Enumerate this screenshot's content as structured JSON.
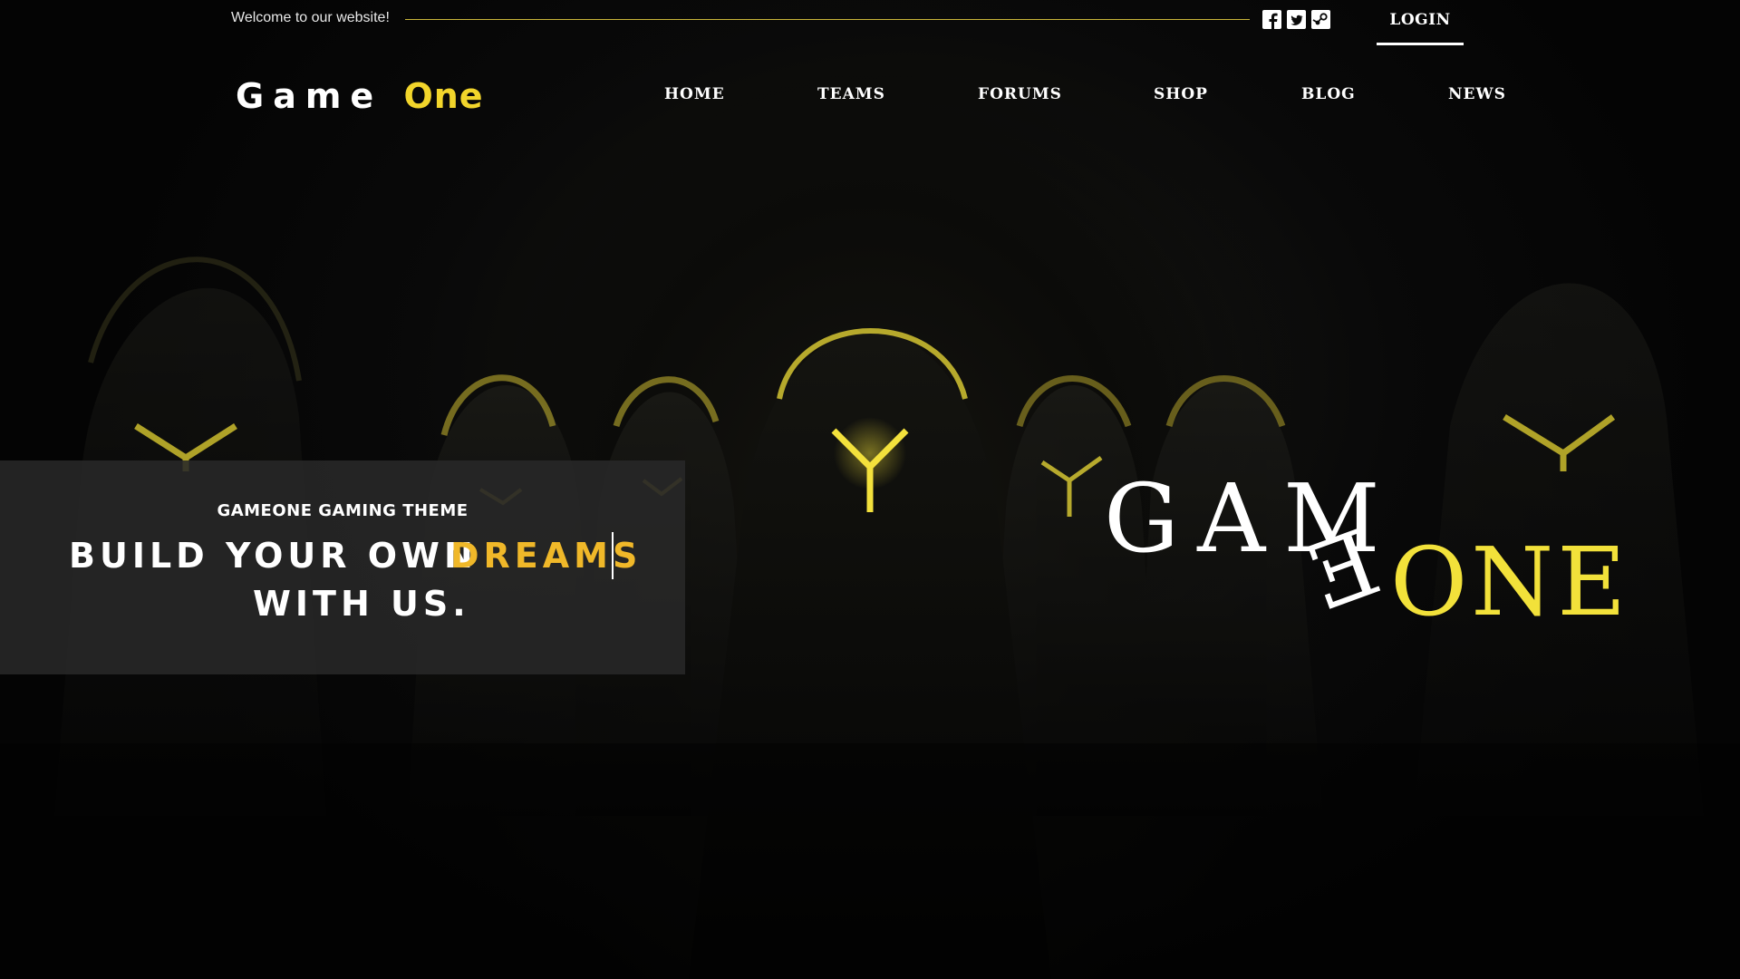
{
  "topbar": {
    "welcome_text": "Welcome to our website!",
    "socials": [
      "facebook-icon",
      "twitter-icon",
      "steam-icon"
    ],
    "login_label": "LOGIN"
  },
  "brand": {
    "logo_part1": "Game",
    "logo_part2": "One",
    "accent_color": "#f2d52b"
  },
  "nav": {
    "items": [
      "HOME",
      "TEAMS",
      "FORUMS",
      "SHOP",
      "BLOG",
      "NEWS"
    ]
  },
  "banner": {
    "subtitle": "GAMEONE GAMING THEME",
    "line1": "BUILD YOUR OWN",
    "highlight": "DREAMS",
    "line2": "WITH US.",
    "highlight_color": "#f0b829"
  },
  "hero_logo": {
    "part1": "GAM",
    "part_e": "E",
    "part2": "ONE"
  }
}
